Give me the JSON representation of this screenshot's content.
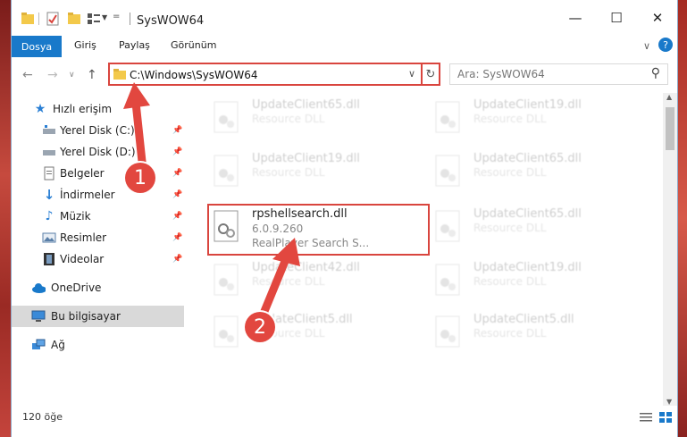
{
  "window": {
    "title": "SysWOW64",
    "minimize_label": "—",
    "maximize_label": "☐",
    "close_label": "✕"
  },
  "ribbon": {
    "tabs": [
      "Dosya",
      "Giriş",
      "Paylaş",
      "Görünüm"
    ],
    "expand_glyph": "∨",
    "help_glyph": "?"
  },
  "address": {
    "path": "C:\\Windows\\SysWOW64",
    "refresh_glyph": "↻",
    "dropdown_glyph": "∨"
  },
  "search": {
    "placeholder": "Ara: SysWOW64",
    "icon_glyph": "⚲"
  },
  "sidebar": {
    "items": [
      {
        "label": "Hızlı erişim",
        "icon": "star-icon",
        "pinned": false
      },
      {
        "label": "Yerel Disk (C:)",
        "icon": "drive-icon",
        "pinned": true
      },
      {
        "label": "Yerel Disk (D:)",
        "icon": "drive-icon",
        "pinned": true
      },
      {
        "label": "Belgeler",
        "icon": "documents-icon",
        "pinned": true
      },
      {
        "label": "İndirmeler",
        "icon": "download-icon",
        "pinned": true
      },
      {
        "label": "Müzik",
        "icon": "music-icon",
        "pinned": true
      },
      {
        "label": "Resimler",
        "icon": "pictures-icon",
        "pinned": true
      },
      {
        "label": "Videolar",
        "icon": "video-icon",
        "pinned": true
      },
      {
        "label": "OneDrive",
        "icon": "cloud-icon",
        "pinned": false
      },
      {
        "label": "Bu bilgisayar",
        "icon": "computer-icon",
        "pinned": false
      },
      {
        "label": "Ağ",
        "icon": "network-icon",
        "pinned": false
      }
    ]
  },
  "files": {
    "left": [
      {
        "name": "UpdateClient65.dll",
        "sub": "Resource DLL"
      },
      {
        "name": "UpdateClient19.dll",
        "sub": "Resource DLL"
      },
      {
        "name": "rpshellsearch.dll",
        "version": "6.0.9.260",
        "sub": "RealPlayer Search S..."
      },
      {
        "name": "UpdateClient42.dll",
        "sub": "Resource DLL"
      },
      {
        "name": "UpdateClient5.dll",
        "sub": "Resource DLL"
      }
    ],
    "right": [
      {
        "name": "UpdateClient19.dll",
        "sub": "Resource DLL"
      },
      {
        "name": "UpdateClient65.dll",
        "sub": "Resource DLL"
      },
      {
        "name": "UpdateClient65.dll",
        "sub": "Resource DLL"
      },
      {
        "name": "UpdateClient19.dll",
        "sub": "Resource DLL"
      },
      {
        "name": "UpdateClient5.dll",
        "sub": "Resource DLL"
      }
    ]
  },
  "status": {
    "count": "120 öğe"
  },
  "callouts": [
    "1",
    "2"
  ],
  "colors": {
    "accent": "#1979ca",
    "highlight": "#d9453e"
  }
}
